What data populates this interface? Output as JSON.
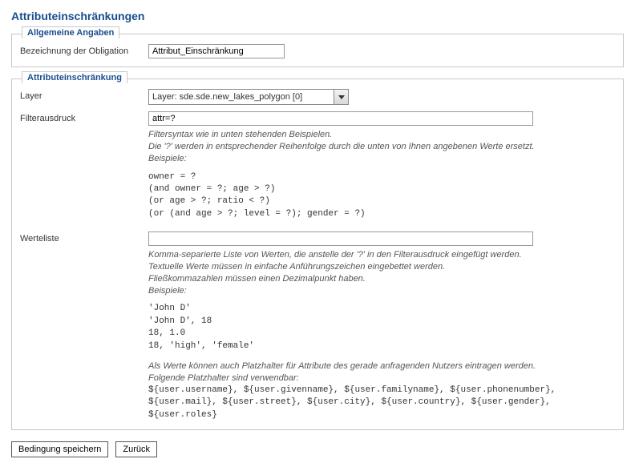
{
  "title": "Attributeinschränkungen",
  "general": {
    "legend": "Allgemeine Angaben",
    "designation_label": "Bezeichnung der Obligation",
    "designation_value": "Attribut_Einschränkung"
  },
  "attr": {
    "legend": "Attributeinschränkung",
    "layer_label": "Layer",
    "layer_value": "Layer: sde.sde.new_lakes_polygon [0]",
    "filter_label": "Filterausdruck",
    "filter_value": "attr=?",
    "filter_help1": "Filtersyntax wie in unten stehenden Beispielen.",
    "filter_help2": "Die '?' werden in entsprechender Reihenfolge durch die unten von Ihnen angebenen Werte ersetzt.",
    "filter_help3": "Beispiele:",
    "filter_examples": "owner = ?\n(and owner = ?; age > ?)\n(or age > ?; ratio < ?)\n(or (and age > ?; level = ?); gender = ?)",
    "values_label": "Werteliste",
    "values_value": "",
    "values_help1": "Komma-separierte Liste von Werten, die anstelle der '?' in den Filterausdruck eingefügt werden.",
    "values_help2": "Textuelle Werte müssen in einfache Anführungszeichen eingebettet werden.",
    "values_help3": "Fließkommazahlen müssen einen Dezimalpunkt haben.",
    "values_help4": "Beispiele:",
    "values_examples": "'John D'\n'John D', 18\n18, 1.0\n18, 'high', 'female'",
    "values_help5": "Als Werte können auch Platzhalter für Attribute des gerade anfragenden Nutzers eintragen werden.",
    "values_help6": "Folgende Platzhalter sind verwendbar:",
    "values_placeholders": "${user.username}, ${user.givenname}, ${user.familyname}, ${user.phonenumber}, ${user.mail}, ${user.street}, ${user.city}, ${user.country}, ${user.gender}, ${user.roles}"
  },
  "buttons": {
    "save": "Bedingung speichern",
    "back": "Zurück"
  }
}
